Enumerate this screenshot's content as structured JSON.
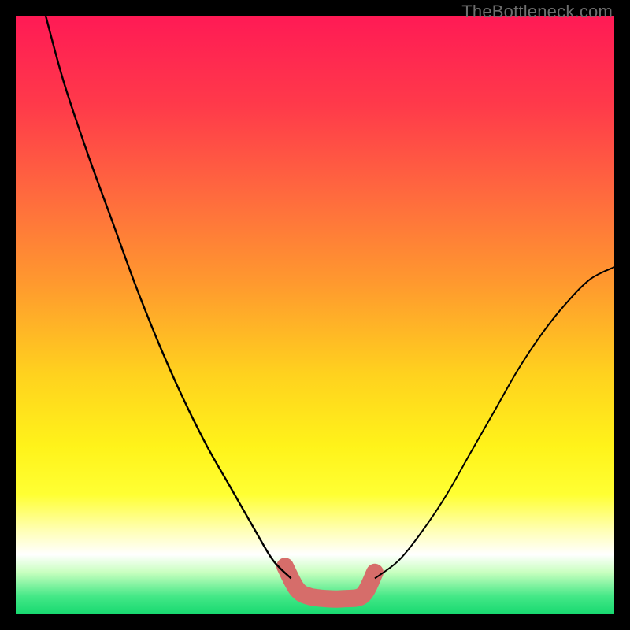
{
  "watermark": "TheBottleneck.com",
  "chart_data": {
    "type": "line",
    "title": "",
    "xlabel": "",
    "ylabel": "",
    "xlim": [
      0,
      100
    ],
    "ylim": [
      0,
      100
    ],
    "annotations": [],
    "background": {
      "type": "vertical-gradient",
      "stops": [
        {
          "offset": 0.0,
          "color": "#ff1a55"
        },
        {
          "offset": 0.15,
          "color": "#ff3a4a"
        },
        {
          "offset": 0.3,
          "color": "#ff6a3e"
        },
        {
          "offset": 0.45,
          "color": "#ff9a2e"
        },
        {
          "offset": 0.6,
          "color": "#ffd21e"
        },
        {
          "offset": 0.72,
          "color": "#fff31a"
        },
        {
          "offset": 0.8,
          "color": "#ffff33"
        },
        {
          "offset": 0.86,
          "color": "#ffffb5"
        },
        {
          "offset": 0.9,
          "color": "#ffffff"
        },
        {
          "offset": 0.93,
          "color": "#c8ffbf"
        },
        {
          "offset": 0.97,
          "color": "#45e887"
        },
        {
          "offset": 1.0,
          "color": "#17d970"
        }
      ]
    },
    "series": [
      {
        "name": "left-curve",
        "color": "#000000",
        "width": 2.4,
        "x": [
          5,
          8,
          12,
          16,
          20,
          24,
          28,
          32,
          36,
          40,
          43,
          46
        ],
        "y": [
          100,
          89,
          77,
          66,
          55,
          45,
          36,
          28,
          21,
          14,
          9,
          6
        ]
      },
      {
        "name": "right-curve",
        "color": "#000000",
        "width": 2.0,
        "x": [
          60,
          64,
          68,
          72,
          76,
          80,
          84,
          88,
          92,
          96,
          100
        ],
        "y": [
          6,
          9,
          14,
          20,
          27,
          34,
          41,
          47,
          52,
          56,
          58
        ]
      },
      {
        "name": "bottom-band",
        "color": "#d66d6a",
        "width": 22,
        "linecap": "round",
        "x": [
          45,
          47,
          49,
          52,
          55,
          58,
          60
        ],
        "y": [
          8.0,
          4.2,
          3.0,
          2.6,
          2.6,
          3.2,
          7.0
        ]
      }
    ]
  }
}
